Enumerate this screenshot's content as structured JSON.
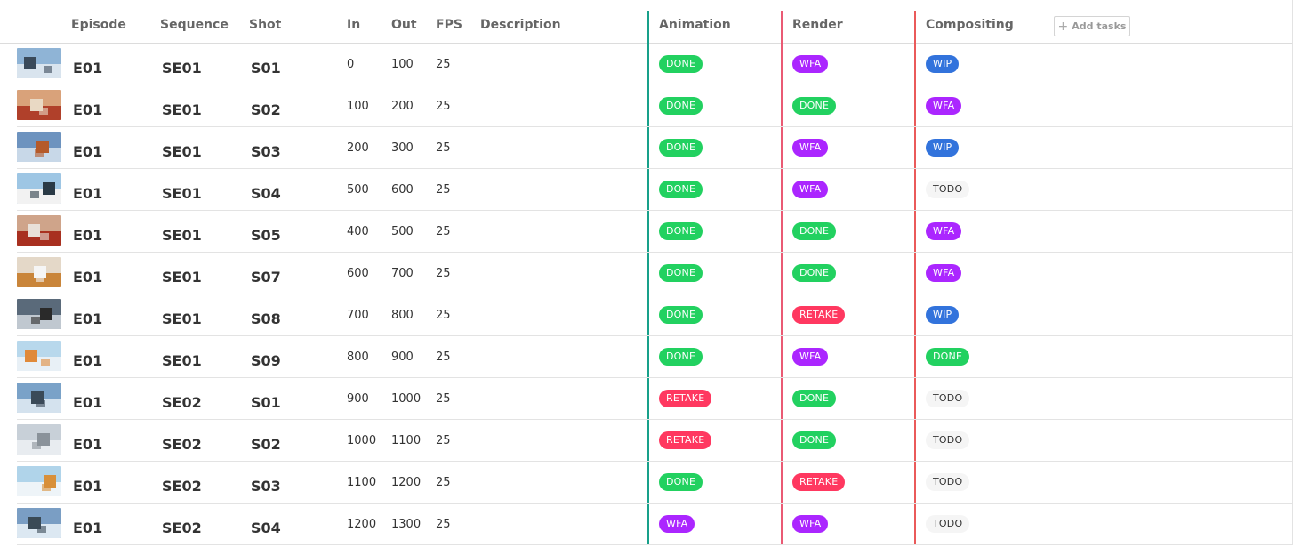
{
  "header": {
    "episode": "Episode",
    "sequence": "Sequence",
    "shot": "Shot",
    "in": "In",
    "out": "Out",
    "fps": "FPS",
    "description": "Description",
    "tasks": [
      "Animation",
      "Render",
      "Compositing"
    ],
    "add_tasks": "Add tasks"
  },
  "task_colors": {
    "animation": "#18a08a",
    "render": "#ea5a74",
    "compositing": "#ea5a5a"
  },
  "status_colors": {
    "DONE": "#22d160",
    "WFA": "#ab26ff",
    "WIP": "#3273dc",
    "RETAKE": "#ff3860",
    "TODO": "#f5f5f5"
  },
  "shots": [
    {
      "episode": "E01",
      "sequence": "SE01",
      "shot": "S01",
      "in": "0",
      "out": "100",
      "fps": "25",
      "description": "",
      "animation": "DONE",
      "render": "WFA",
      "compositing": "WIP"
    },
    {
      "episode": "E01",
      "sequence": "SE01",
      "shot": "S02",
      "in": "100",
      "out": "200",
      "fps": "25",
      "description": "",
      "animation": "DONE",
      "render": "DONE",
      "compositing": "WFA"
    },
    {
      "episode": "E01",
      "sequence": "SE01",
      "shot": "S03",
      "in": "200",
      "out": "300",
      "fps": "25",
      "description": "",
      "animation": "DONE",
      "render": "WFA",
      "compositing": "WIP"
    },
    {
      "episode": "E01",
      "sequence": "SE01",
      "shot": "S04",
      "in": "500",
      "out": "600",
      "fps": "25",
      "description": "",
      "animation": "DONE",
      "render": "WFA",
      "compositing": "TODO"
    },
    {
      "episode": "E01",
      "sequence": "SE01",
      "shot": "S05",
      "in": "400",
      "out": "500",
      "fps": "25",
      "description": "",
      "animation": "DONE",
      "render": "DONE",
      "compositing": "WFA"
    },
    {
      "episode": "E01",
      "sequence": "SE01",
      "shot": "S07",
      "in": "600",
      "out": "700",
      "fps": "25",
      "description": "",
      "animation": "DONE",
      "render": "DONE",
      "compositing": "WFA"
    },
    {
      "episode": "E01",
      "sequence": "SE01",
      "shot": "S08",
      "in": "700",
      "out": "800",
      "fps": "25",
      "description": "",
      "animation": "DONE",
      "render": "RETAKE",
      "compositing": "WIP"
    },
    {
      "episode": "E01",
      "sequence": "SE01",
      "shot": "S09",
      "in": "800",
      "out": "900",
      "fps": "25",
      "description": "",
      "animation": "DONE",
      "render": "WFA",
      "compositing": "DONE"
    },
    {
      "episode": "E01",
      "sequence": "SE02",
      "shot": "S01",
      "in": "900",
      "out": "1000",
      "fps": "25",
      "description": "",
      "animation": "RETAKE",
      "render": "DONE",
      "compositing": "TODO"
    },
    {
      "episode": "E01",
      "sequence": "SE02",
      "shot": "S02",
      "in": "1000",
      "out": "1100",
      "fps": "25",
      "description": "",
      "animation": "RETAKE",
      "render": "DONE",
      "compositing": "TODO"
    },
    {
      "episode": "E01",
      "sequence": "SE02",
      "shot": "S03",
      "in": "1100",
      "out": "1200",
      "fps": "25",
      "description": "",
      "animation": "DONE",
      "render": "RETAKE",
      "compositing": "TODO"
    },
    {
      "episode": "E01",
      "sequence": "SE02",
      "shot": "S04",
      "in": "1200",
      "out": "1300",
      "fps": "25",
      "description": "",
      "animation": "WFA",
      "render": "WFA",
      "compositing": "TODO"
    }
  ]
}
